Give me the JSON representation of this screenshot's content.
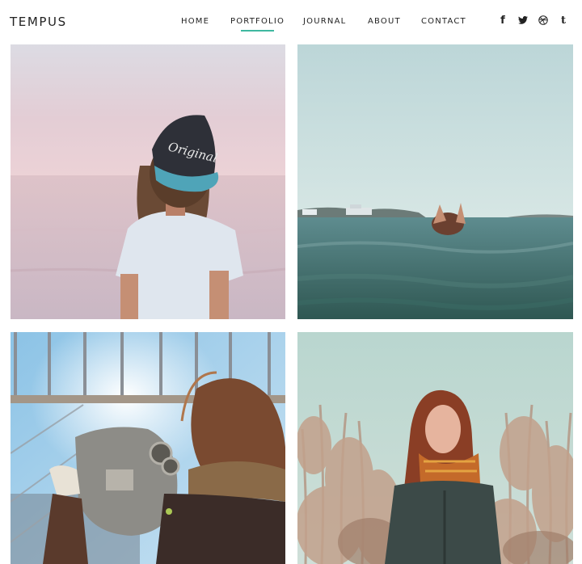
{
  "brand": {
    "name": "TEMPUS"
  },
  "nav": {
    "items": [
      {
        "label": "HOME"
      },
      {
        "label": "PORTFOLIO",
        "active": true
      },
      {
        "label": "JOURNAL"
      },
      {
        "label": "ABOUT"
      },
      {
        "label": "CONTACT"
      }
    ]
  },
  "social": {
    "icons": [
      "facebook-icon",
      "twitter-icon",
      "dribbble-icon",
      "tumblr-icon"
    ],
    "facebook_glyph": "f",
    "tumblr_glyph": "t"
  },
  "photos": [
    {
      "subject": "woman-with-cap-by-sea"
    },
    {
      "subject": "person-swimming-in-sea"
    },
    {
      "subject": "woman-at-coin-binoculars"
    },
    {
      "subject": "woman-in-field"
    }
  ],
  "photo_cap_text": "Original",
  "colors": {
    "accent": "#3fb8a0",
    "text": "#222222",
    "background": "#ffffff"
  }
}
